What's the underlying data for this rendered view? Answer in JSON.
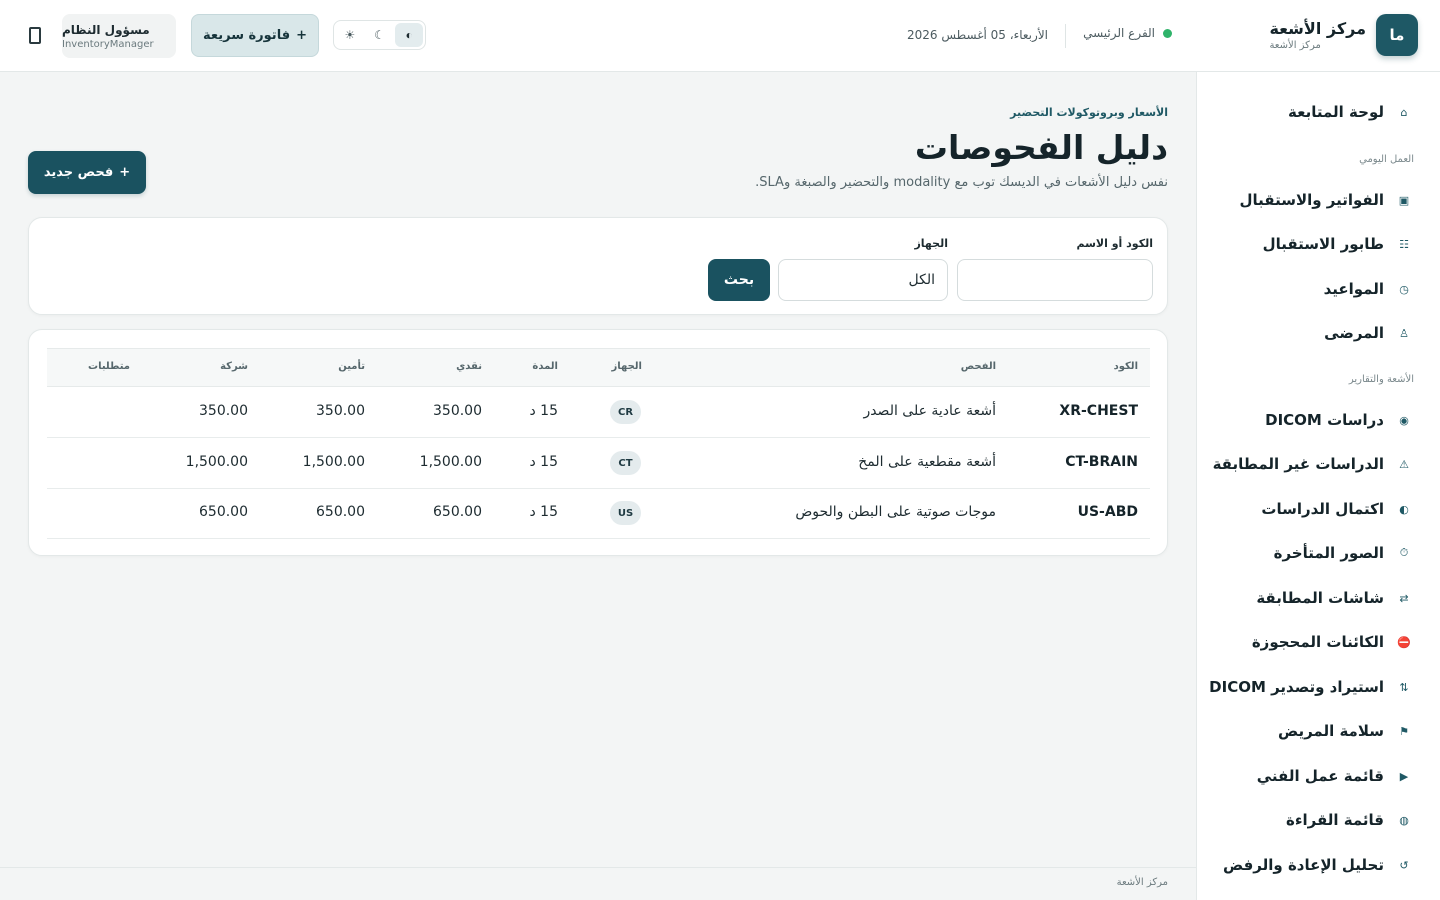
{
  "header": {
    "brand_logo": "ما",
    "brand_title": "مركز الأشعة",
    "brand_subtitle": "مركز الأشعة",
    "branch_label": "الفرع الرئيسي",
    "branch_status_color": "#2fb36a",
    "date": "الأربعاء، 05 أغسطس 2026",
    "theme_options": [
      "☀",
      "☾",
      "◐"
    ],
    "quick_invoice_label": "فاتورة سريعة",
    "quick_invoice_icon": "+",
    "user_name": "مسؤول النظام",
    "user_role": "InventoryManager",
    "mobile_icon": "device-mobile-icon"
  },
  "sidebar": {
    "dashboard": {
      "label": "لوحة المتابعة",
      "icon": "⌂"
    },
    "section_daily": "العمل اليومي",
    "daily_items": [
      {
        "label": "الفواتير والاستقبال",
        "icon": "▣"
      },
      {
        "label": "طابور الاستقبال",
        "icon": "☷"
      },
      {
        "label": "المواعيد",
        "icon": "◷"
      },
      {
        "label": "المرضى",
        "icon": "♙"
      }
    ],
    "section_radiology": "الأشعة والتقارير",
    "radiology_items": [
      {
        "label": "دراسات DICOM",
        "icon": "◉"
      },
      {
        "label": "الدراسات غير المطابقة",
        "icon": "⚠"
      },
      {
        "label": "اكتمال الدراسات",
        "icon": "◐"
      },
      {
        "label": "الصور المتأخرة",
        "icon": "⏱"
      },
      {
        "label": "شاشات المطابقة",
        "icon": "⇄"
      },
      {
        "label": "الكائنات المحجوزة",
        "icon": "⛔"
      },
      {
        "label": "استيراد وتصدير DICOM",
        "icon": "⇅"
      },
      {
        "label": "سلامة المريض",
        "icon": "⚑"
      },
      {
        "label": "قائمة عمل الفني",
        "icon": "▶"
      },
      {
        "label": "قائمة القراءة",
        "icon": "◍"
      },
      {
        "label": "تحليل الإعادة والرفض",
        "icon": "↺"
      }
    ]
  },
  "main": {
    "kicker": "الأسعار وبروتوكولات التحضير",
    "title": "دليل الفحوصات",
    "subtitle": "نفس دليل الأشعات في الديسك توب مع modality والتحضير والصبغة وSLA.",
    "new_exam_label": "فحص جديد",
    "new_exam_icon": "+"
  },
  "filters": {
    "code_label": "الكود أو الاسم",
    "code_value": "",
    "device_label": "الجهاز",
    "device_selected": "الكل",
    "search_label": "بحث"
  },
  "table": {
    "columns": {
      "code": "الكود",
      "exam": "الفحص",
      "device": "الجهاز",
      "duration": "المدة",
      "cash": "نقدي",
      "insurance": "تأمين",
      "company": "شركة",
      "requirements": "متطلبات"
    },
    "rows": [
      {
        "code": "XR-CHEST",
        "exam": "أشعة عادية على الصدر",
        "device": "CR",
        "duration": "15 د",
        "cash": "350.00",
        "insurance": "350.00",
        "company": "350.00",
        "requirements": ""
      },
      {
        "code": "CT-BRAIN",
        "exam": "أشعة مقطعية على المخ",
        "device": "CT",
        "duration": "15 د",
        "cash": "1,500.00",
        "insurance": "1,500.00",
        "company": "1,500.00",
        "requirements": ""
      },
      {
        "code": "US-ABD",
        "exam": "موجات صوتية على البطن والحوض",
        "device": "US",
        "duration": "15 د",
        "cash": "650.00",
        "insurance": "650.00",
        "company": "650.00",
        "requirements": ""
      }
    ]
  },
  "footer": {
    "text": "مركز الأشعة"
  },
  "colors": {
    "primary": "#1a5260",
    "accent_light": "#d9e7e9",
    "background": "#f3f5f5"
  }
}
